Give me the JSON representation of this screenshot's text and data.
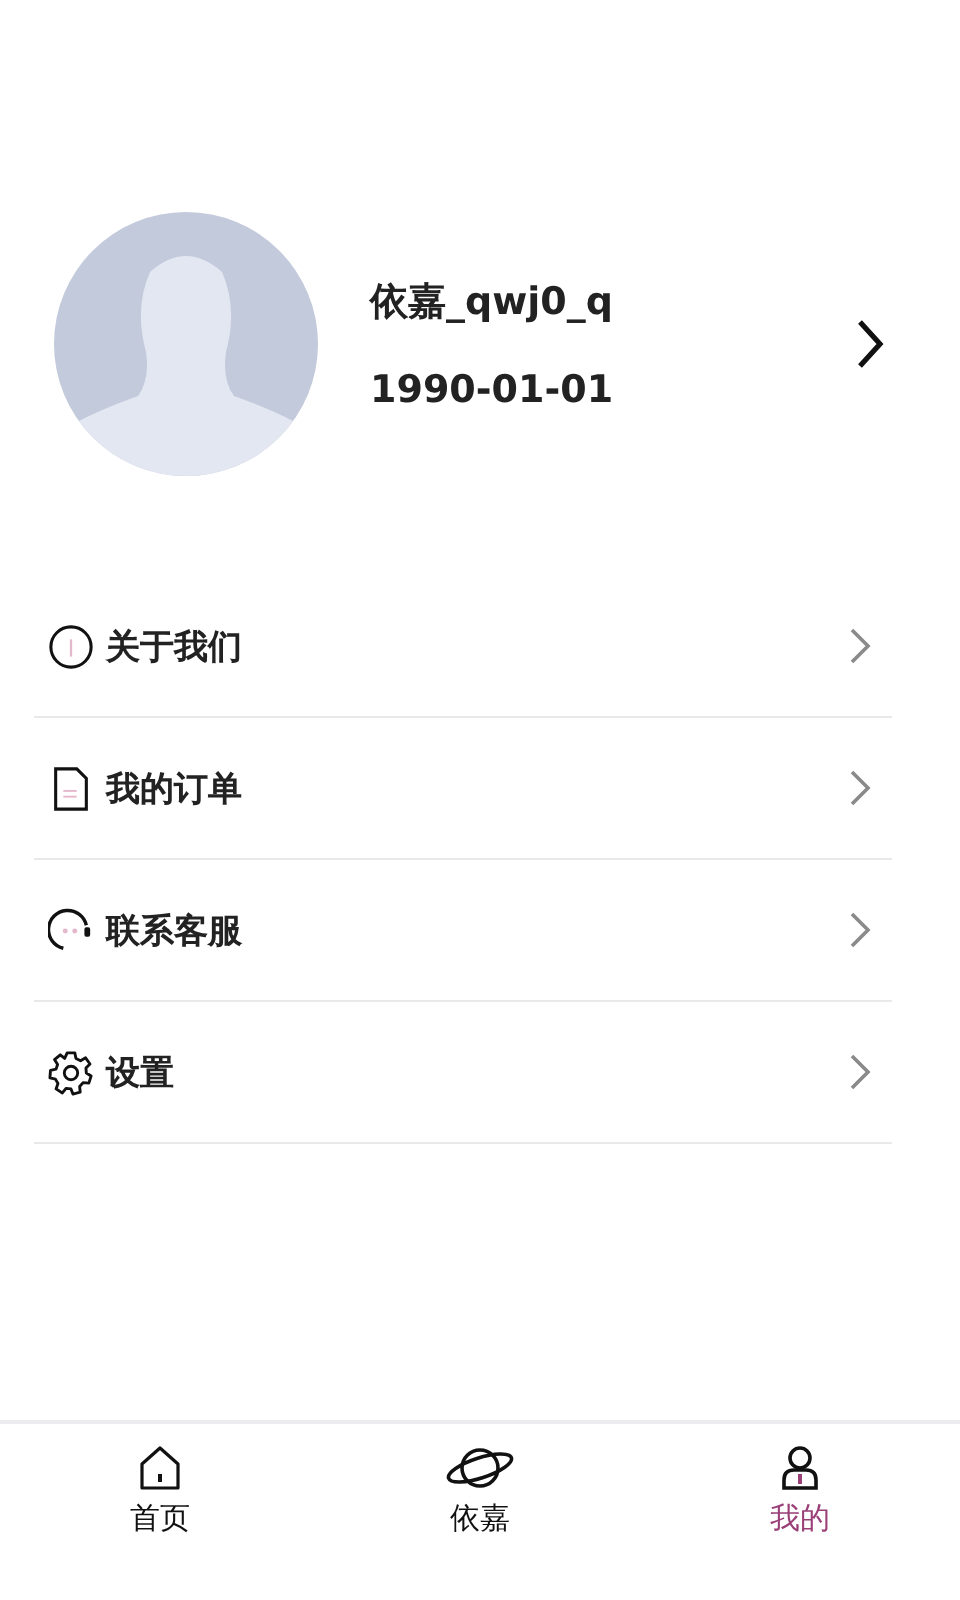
{
  "profile": {
    "name": "依嘉_qwj0_q",
    "birthday": "1990-01-01"
  },
  "menu": [
    {
      "kind": "info",
      "label": "关于我们"
    },
    {
      "kind": "document",
      "label": "我的订单"
    },
    {
      "kind": "headset",
      "label": "联系客服"
    },
    {
      "kind": "gear",
      "label": "设置"
    }
  ],
  "tab_bar": [
    {
      "kind": "home",
      "label": "首页",
      "selected": false
    },
    {
      "kind": "planet",
      "label": "依嘉",
      "selected": false
    },
    {
      "kind": "person",
      "label": "我的",
      "selected": true
    }
  ]
}
